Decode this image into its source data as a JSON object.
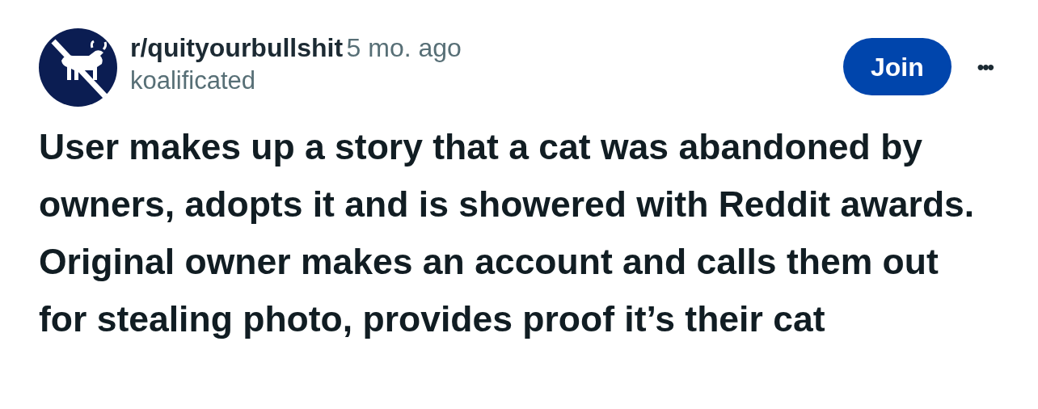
{
  "post": {
    "subreddit": "r/quityourbullshit",
    "time": "5 mo. ago",
    "author": "koalificated",
    "join_label": "Join",
    "more_label": "•••",
    "title": "User makes up a story that a cat was abandoned by owners, adopts it and is showered with Reddit awards. Original owner makes an account and calls them out for stealing photo, provides proof it’s their cat"
  }
}
